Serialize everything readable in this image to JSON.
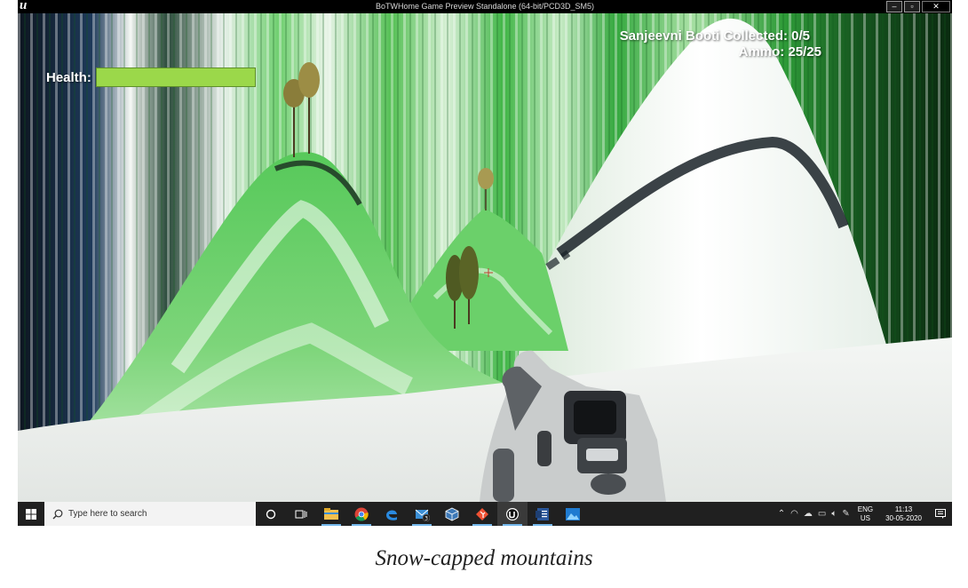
{
  "window": {
    "title": "BoTWHome Game Preview Standalone (64-bit/PCD3D_SM5)",
    "logo_text": "u",
    "controls": {
      "minimize": "–",
      "maximize": "▫",
      "close": "✕"
    }
  },
  "hud": {
    "health_label": "Health:",
    "health_fraction": 1.0,
    "health_color": "#9bd84a",
    "collected": "Sanjeevni Booti Collected: 0/5",
    "ammo": "Ammo: 25/25"
  },
  "taskbar": {
    "search_placeholder": "Type here to search",
    "pinned": [
      {
        "name": "cortana-icon"
      },
      {
        "name": "task-view-icon"
      },
      {
        "name": "file-explorer-icon"
      },
      {
        "name": "chrome-icon"
      },
      {
        "name": "edge-icon"
      },
      {
        "name": "outlook-icon",
        "badge": "3"
      },
      {
        "name": "virtualbox-icon"
      },
      {
        "name": "git-icon"
      },
      {
        "name": "unreal-icon"
      },
      {
        "name": "word-icon"
      },
      {
        "name": "photos-icon"
      }
    ],
    "language_top": "ENG",
    "language_bottom": "US",
    "time": "11:13",
    "date": "30-05-2020"
  },
  "caption": "Snow-capped mountains"
}
